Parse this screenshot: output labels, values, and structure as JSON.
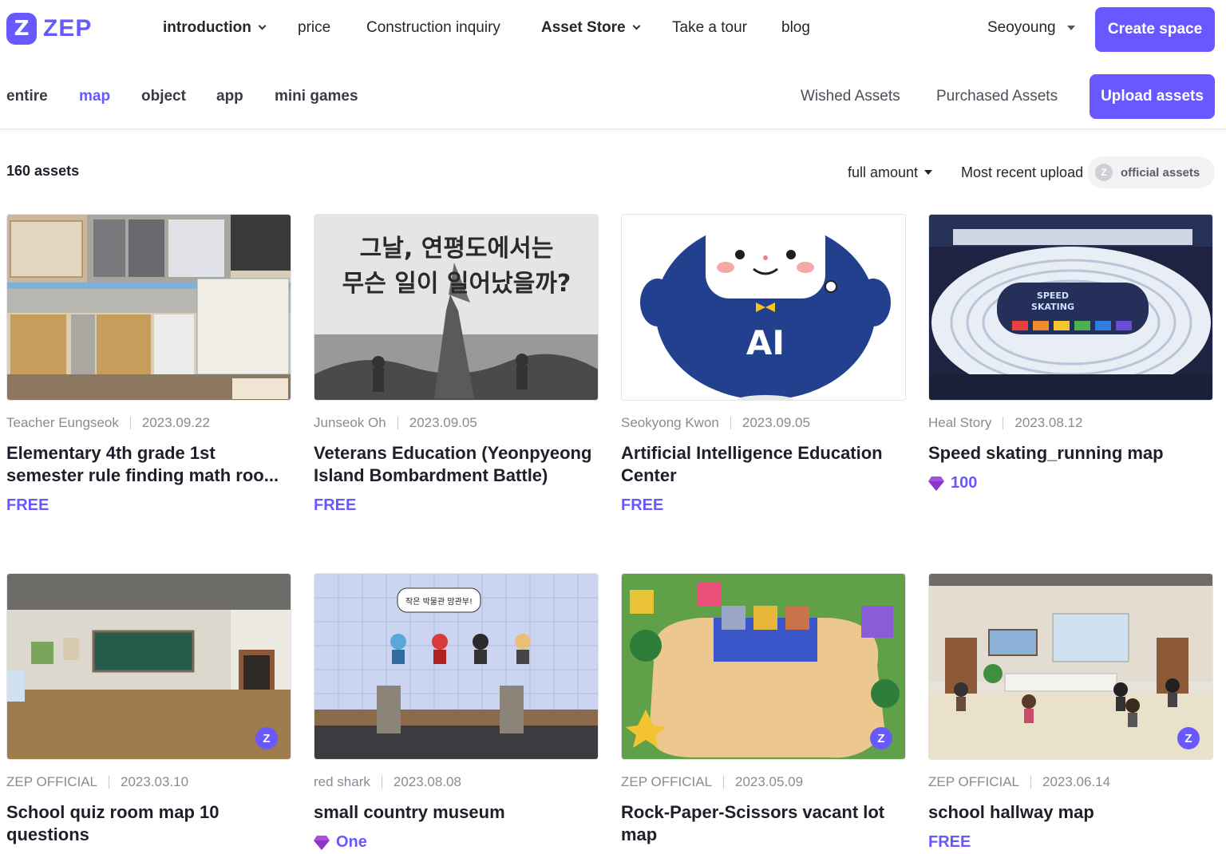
{
  "brand": {
    "logo_mark": "Z",
    "name": "ZEP",
    "color": "#6758ff"
  },
  "nav": {
    "items": [
      {
        "label": "introduction",
        "dropdown": true
      },
      {
        "label": "price",
        "dropdown": false
      },
      {
        "label": "Construction inquiry",
        "dropdown": false
      },
      {
        "label": "Asset Store",
        "dropdown": true
      },
      {
        "label": "Take a tour",
        "dropdown": false
      },
      {
        "label": "blog",
        "dropdown": false
      }
    ],
    "user": "Seoyoung",
    "create_space": "Create space"
  },
  "subnav": {
    "tabs": [
      "entire",
      "map",
      "object",
      "app",
      "mini games"
    ],
    "active_tab": "map",
    "wished": "Wished Assets",
    "purchased": "Purchased Assets",
    "upload": "Upload assets"
  },
  "filters": {
    "count": "160 assets",
    "price_filter": "full amount",
    "sort": "Most recent upload",
    "official": "official assets",
    "official_icon": "z-icon"
  },
  "cards": [
    {
      "author": "Teacher Eungseok",
      "date": "2023.09.22",
      "title": "Elementary 4th grade 1st semester rule finding math roo...",
      "price": "FREE",
      "gem": false,
      "official": false
    },
    {
      "author": "Junseok Oh",
      "date": "2023.09.05",
      "title": "Veterans Education (Yeonpyeong Island Bombardment Battle)",
      "price": "FREE",
      "gem": false,
      "official": false,
      "thumb_text_1": "그날, 연평도에서는",
      "thumb_text_2": "무슨 일이 일어났을까?"
    },
    {
      "author": "Seokyong Kwon",
      "date": "2023.09.05",
      "title": "Artificial Intelligence Education Center",
      "price": "FREE",
      "gem": false,
      "official": false,
      "thumb_text_1": "AI"
    },
    {
      "author": "Heal Story",
      "date": "2023.08.12",
      "title": "Speed skating_running map",
      "price": "100",
      "gem": true,
      "official": false,
      "thumb_text_1": "SPEED",
      "thumb_text_2": "SKATING"
    },
    {
      "author": "ZEP OFFICIAL",
      "date": "2023.03.10",
      "title": "School quiz room map 10 questions",
      "price": "",
      "gem": false,
      "official": true
    },
    {
      "author": "red shark",
      "date": "2023.08.08",
      "title": "small country museum",
      "price": "One",
      "gem": true,
      "official": false,
      "thumb_text_1": "작은 박물관 맘관부!"
    },
    {
      "author": "ZEP OFFICIAL",
      "date": "2023.05.09",
      "title": "Rock-Paper-Scissors vacant lot map",
      "price": "",
      "gem": false,
      "official": true
    },
    {
      "author": "ZEP OFFICIAL",
      "date": "2023.06.14",
      "title": "school hallway map",
      "price": "FREE",
      "gem": false,
      "official": true
    }
  ]
}
